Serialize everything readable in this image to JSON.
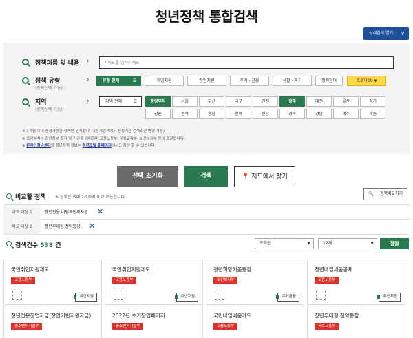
{
  "header": {
    "title": "청년정책 통합검색",
    "detail_button": "상세검색 열기",
    "chevron": "∨"
  },
  "search": {
    "keyword_label": "정책이름 및 내용",
    "keyword_placeholder": "키워드를 입력하세요",
    "type_label": "정책 유형",
    "type_sub": "(중복선택 가능)",
    "types": [
      "유형 전체",
      "취업지원",
      "창업지원",
      "주거 · 금융",
      "생활 · 복지",
      "정책참여",
      "코로나19"
    ],
    "region_label": "지역",
    "region_sub": "(중복선택 가능)",
    "regions_row1": [
      "지역 전체",
      "중앙부처",
      "서울",
      "부산",
      "대구",
      "인천",
      "광주",
      "대전",
      "울산",
      "경기"
    ],
    "regions_row2": [
      "강원",
      "충북",
      "충남",
      "전북",
      "전남",
      "경북",
      "경남",
      "제주",
      "세종"
    ],
    "notes": [
      "※ 1개월 이내 신청가능한 정책만 검색됩니다.(상세검색에서 신청기간 검색조건 변경 가능)",
      "※ 중앙부처는 중앙정부 조직 및 기관을 의미하며 고용노동부, 국토교통부, 보건복지부 등이 포함됩니다."
    ],
    "note3_prefix": "※",
    "note3_link1": "온라인청년센터",
    "note3_mid": "의 청년정책 정보는",
    "note3_link2": "청년포털 홈페이지",
    "note3_suffix": "에서도 확인 할 수 있습니다."
  },
  "buttons": {
    "reset": "선택 초기화",
    "search": "검색",
    "map": "지도에서 찾기"
  },
  "compare": {
    "title": "비교할 정책",
    "note": "※ 정책은 최대 2개까지 비교 가능합니다.",
    "button": "정책비교하기",
    "rows": [
      {
        "label": "비교 대상 1",
        "item": "청년전용 버팀목전세자금"
      },
      {
        "label": "비교 대상 2",
        "item": "청년우대형 청약통장"
      }
    ]
  },
  "results": {
    "prefix": "검색건수",
    "count": "538",
    "suffix": "건",
    "sort_select": "조회순",
    "page_select": "12개",
    "sort_button": "정렬"
  },
  "cards": [
    {
      "title": "국민취업지원제도",
      "badge": "고용노동부",
      "badge_color": "#d9342b",
      "tag": "취업지원"
    },
    {
      "title": "국민취업지원제도",
      "badge": "고용노동부",
      "badge_color": "#d9342b",
      "tag": "취업지원"
    },
    {
      "title": "청년희망키움통장",
      "badge": "보건복지부",
      "badge_color": "#d9342b",
      "tag": "주거금융"
    },
    {
      "title": "청년내일채움공제",
      "badge": "고용노동부",
      "badge_color": "#d9342b",
      "tag": "취업지원"
    },
    {
      "title": "청년전용창업자금(창업기반지원자금)",
      "badge": "중소벤처기업부",
      "badge_color": "#d9342b"
    },
    {
      "title": "2022년 초기창업패키지",
      "badge": "중소벤처기업부",
      "badge_color": "#d9342b"
    },
    {
      "title": "국민내일배움카드",
      "badge": "고용노동부",
      "badge_color": "#d9342b"
    },
    {
      "title": "청년우대형 청약통장",
      "badge": "국토교통부",
      "badge_color": "#d9342b"
    }
  ],
  "colors": {
    "accent_green": "#2b7a4f",
    "navy": "#1e4f9a",
    "badge_red": "#d9342b",
    "covid_yellow": "#ffd94a"
  }
}
